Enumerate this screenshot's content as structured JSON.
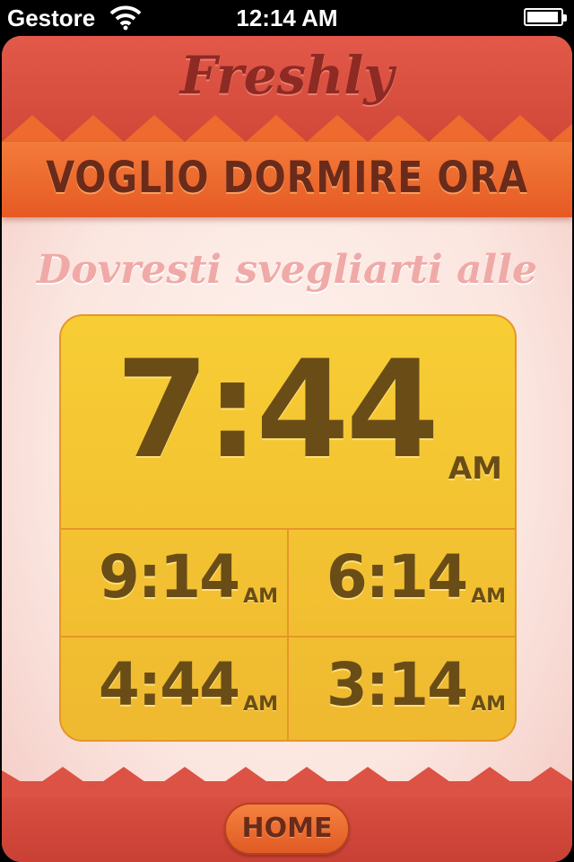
{
  "status_bar": {
    "carrier": "Gestore",
    "time": "12:14 AM"
  },
  "app": {
    "logo": "Freshly",
    "banner_title": "VOGLIO DORMIRE ORA",
    "subtitle": "Dovresti svegliarti alle",
    "main_time": {
      "digits": "7:44",
      "ampm": "AM"
    },
    "alt_times": [
      {
        "digits": "9:14",
        "ampm": "AM"
      },
      {
        "digits": "6:14",
        "ampm": "AM"
      },
      {
        "digits": "4:44",
        "ampm": "AM"
      },
      {
        "digits": "3:14",
        "ampm": "AM"
      }
    ],
    "home_button": "HOME"
  },
  "colors": {
    "header_red": "#d44c3d",
    "banner_orange": "#ee6a2e",
    "box_yellow": "#f4c432",
    "text_brown": "#6a4d16"
  },
  "icons": [
    "wifi-icon",
    "battery-icon"
  ]
}
